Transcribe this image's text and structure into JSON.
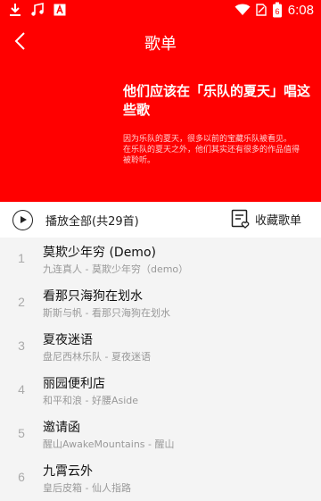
{
  "status_bar": {
    "time": "6:08",
    "battery_level": "6",
    "icons": [
      "download-icon",
      "music-icon",
      "a-icon",
      "wifi-icon",
      "sim-icon",
      "battery-icon"
    ]
  },
  "app_bar": {
    "title": "歌单",
    "back_icon": "chevron-left-icon"
  },
  "playlist": {
    "title": "他们应该在「乐队的夏天」唱这些歌",
    "description": "因为乐队的夏天，很多以前的宝藏乐队被看见。\n在乐队的夏天之外，他们其实还有很多的作品值得被聆听。"
  },
  "actions": {
    "play_all_label": "播放全部(共29首)",
    "collect_label": "收藏歌单"
  },
  "songs": [
    {
      "index": "1",
      "title": "莫欺少年穷 (Demo)",
      "subtitle": "九连真人 - 莫欺少年穷（demo）"
    },
    {
      "index": "2",
      "title": "看那只海狗在划水",
      "subtitle": "斯斯与帆 - 看那只海狗在划水"
    },
    {
      "index": "3",
      "title": "夏夜迷语",
      "subtitle": "盘尼西林乐队 - 夏夜迷语"
    },
    {
      "index": "4",
      "title": "丽园便利店",
      "subtitle": "和平和浪 - 好腰Aside"
    },
    {
      "index": "5",
      "title": "邀请函",
      "subtitle": "醒山AwakeMountains - 醒山"
    },
    {
      "index": "6",
      "title": "九霄云外",
      "subtitle": "皇后皮箱 - 仙人指路"
    }
  ],
  "colors": {
    "accent": "#ff0000",
    "list_bg": "#f4f4f4",
    "subtitle": "#999999"
  }
}
